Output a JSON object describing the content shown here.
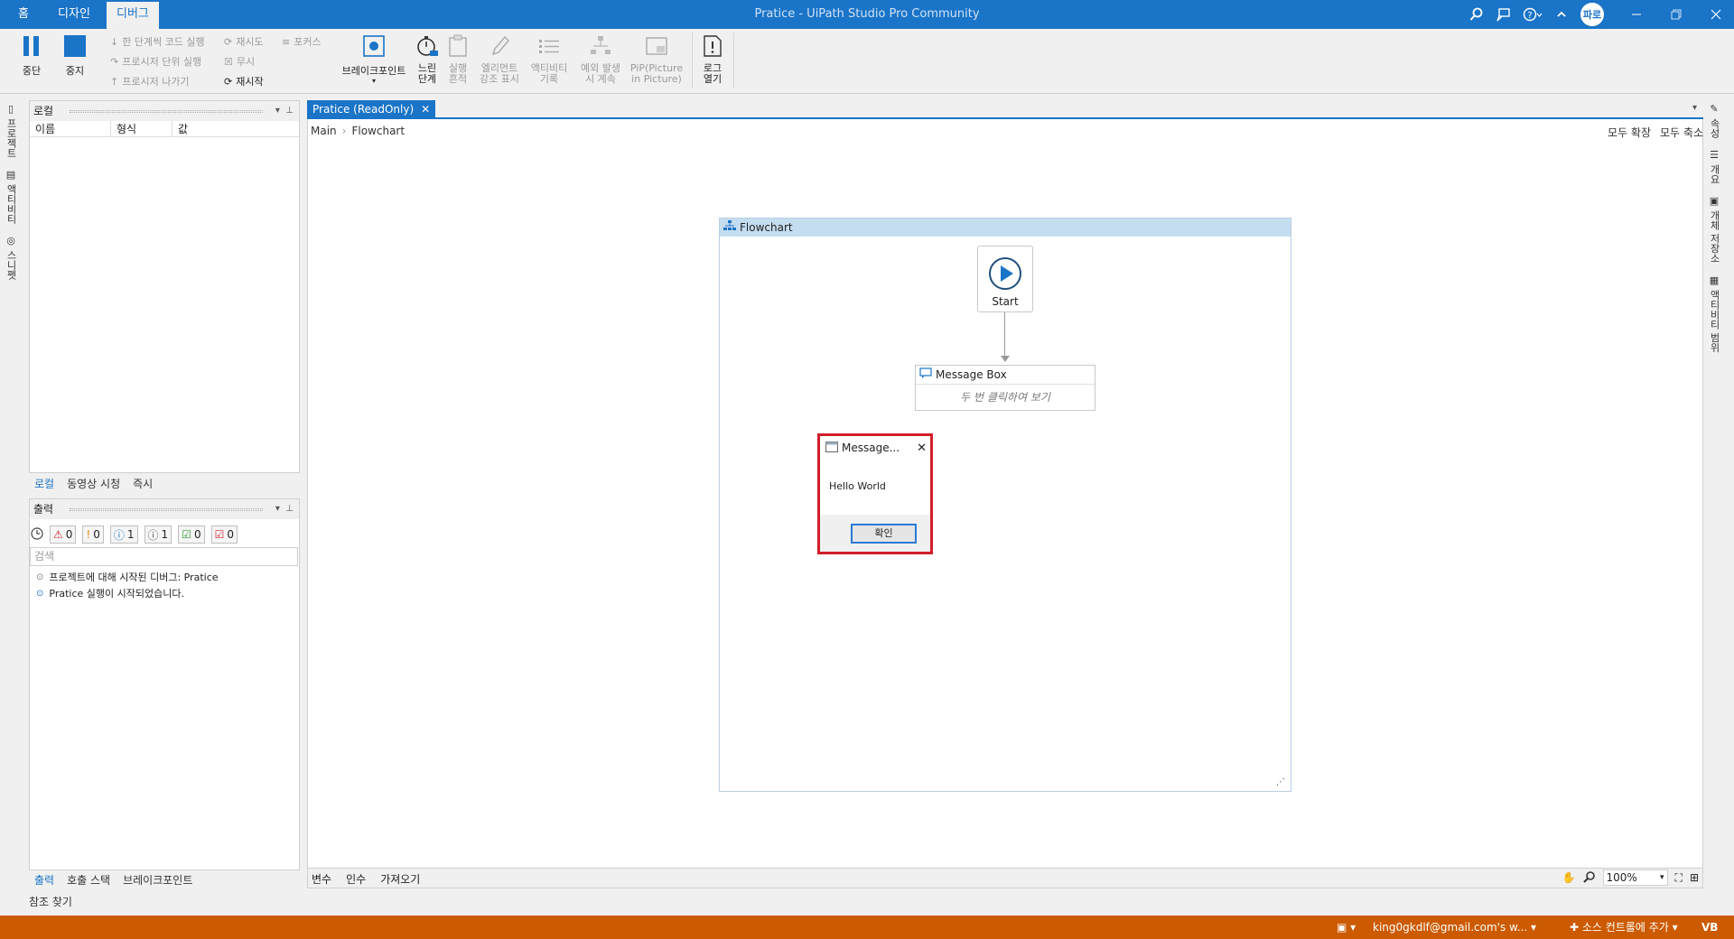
{
  "titlebar": {
    "home_label": "홈",
    "tabs": [
      "디자인",
      "디버그"
    ],
    "title": "Pratice - UiPath Studio Pro Community",
    "user_initials": "파로"
  },
  "ribbon": {
    "pause": "중단",
    "stop": "중지",
    "step_into": "한 단계씩 코드 실행",
    "step_over": "프로시저 단위 실행",
    "step_out": "프로시저 나가기",
    "retry": "재시도",
    "ignore": "무시",
    "restart": "재시작",
    "focus": "포커스",
    "breakpoints": "브레이크포인트",
    "slow_step_l1": "느린",
    "slow_step_l2": "단계",
    "execution_trail_l1": "실행",
    "execution_trail_l2": "흔적",
    "highlight_elements_l1": "엘리먼트",
    "highlight_elements_l2": "강조 표시",
    "log_activities_l1": "액티비티",
    "log_activities_l2": "기록",
    "continue_on_exception_l1": "예외 발생",
    "continue_on_exception_l2": "시 계속",
    "pip_l1": "PiP(Picture",
    "pip_l2": "in Picture)",
    "open_logs_l1": "로그",
    "open_logs_l2": "열기"
  },
  "left_strip": [
    "프로젝트",
    "액티비티",
    "스니펫"
  ],
  "locals_panel": {
    "title": "로컬",
    "columns": [
      "이름",
      "형식",
      "값"
    ],
    "tabs": [
      "로컬",
      "동영상 시청",
      "즉시"
    ]
  },
  "output_panel": {
    "title": "출력",
    "filters": [
      {
        "icon": "error-icon",
        "count": "0",
        "color": "#d11f2a"
      },
      {
        "icon": "warning-icon",
        "count": "0",
        "color": "#e08a00"
      },
      {
        "icon": "info-icon",
        "count": "1",
        "color": "#1a74c8"
      },
      {
        "icon": "trace-icon",
        "count": "1",
        "color": "#555555"
      },
      {
        "icon": "success-icon",
        "count": "0",
        "color": "#2f9b2f"
      },
      {
        "icon": "fail-check-icon",
        "count": "0",
        "color": "#d11f2a"
      }
    ],
    "search_placeholder": "검색",
    "lines": [
      "프로젝트에 대해 시작된 디버그: Pratice",
      "Pratice 실행이 시작되었습니다."
    ],
    "tabs": [
      "출력",
      "호출 스택",
      "브레이크포인트"
    ]
  },
  "find_references": "참조 찾기",
  "designer": {
    "doc_tab": "Pratice (ReadOnly)",
    "breadcrumb": [
      "Main",
      "Flowchart"
    ],
    "expand_all": "모두 확장",
    "collapse_all": "모두 축소",
    "flowchart_title": "Flowchart",
    "start_label": "Start",
    "message_box_title": "Message Box",
    "message_box_hint": "두 번 클릭하여 보기",
    "bottom_tabs": [
      "변수",
      "인수",
      "가져오기"
    ],
    "zoom": "100%"
  },
  "dialog": {
    "title": "Message...",
    "message": "Hello World",
    "ok": "확인"
  },
  "right_strip": [
    "속성",
    "개요",
    "개체 저장소",
    "액티비티 범위"
  ],
  "statusbar": {
    "account": "king0gkdlf@gmail.com's w...",
    "source_control": "소스 컨트롤에 추가",
    "language": "VB"
  },
  "colors": {
    "accent": "#1a74c8",
    "status": "#cc5a00",
    "highlight": "#d11f2a"
  }
}
